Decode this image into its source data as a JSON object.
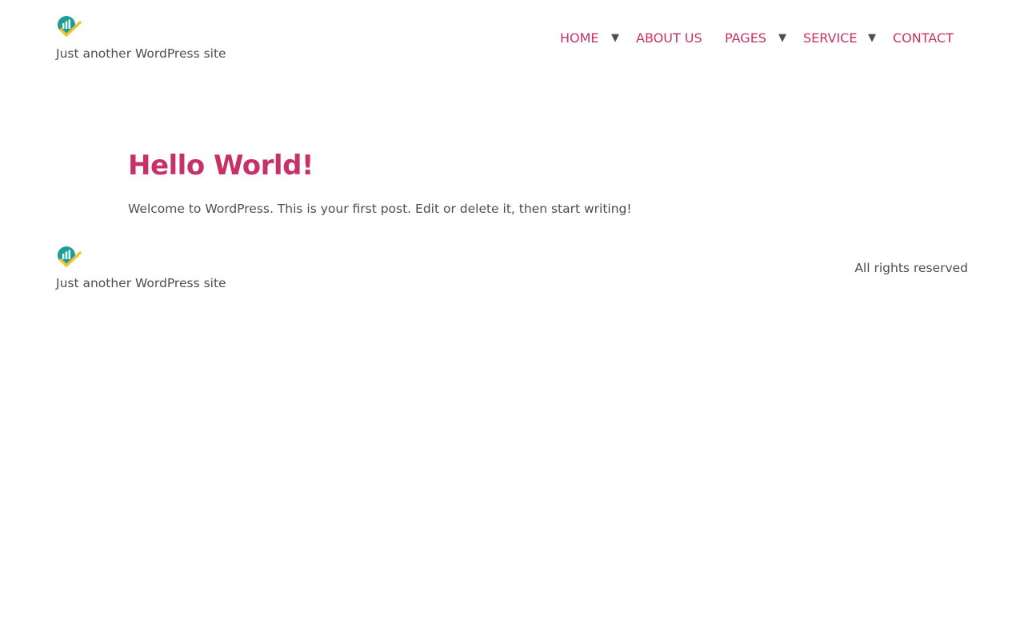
{
  "header": {
    "logo_icon": "bar-chart-checkmark-logo",
    "tagline": "Just another WordPress site"
  },
  "nav": {
    "items": [
      {
        "label": "HOME",
        "has_dropdown": true
      },
      {
        "label": "ABOUT US",
        "has_dropdown": false
      },
      {
        "label": "PAGES",
        "has_dropdown": true
      },
      {
        "label": "SERVICE",
        "has_dropdown": true
      },
      {
        "label": "CONTACT",
        "has_dropdown": false
      }
    ],
    "caret_glyph": "▼"
  },
  "post": {
    "title": "Hello World!",
    "body": "Welcome to WordPress. This is your first post. Edit or delete it, then start writing!"
  },
  "footer": {
    "logo_icon": "bar-chart-checkmark-logo",
    "tagline": "Just another WordPress site",
    "copyright": "All rights reserved"
  },
  "colors": {
    "accent": "#c73266",
    "text": "#4a4f55",
    "logo_teal": "#1a9e9a",
    "logo_yellow": "#f2c230",
    "background": "#ffffff"
  }
}
